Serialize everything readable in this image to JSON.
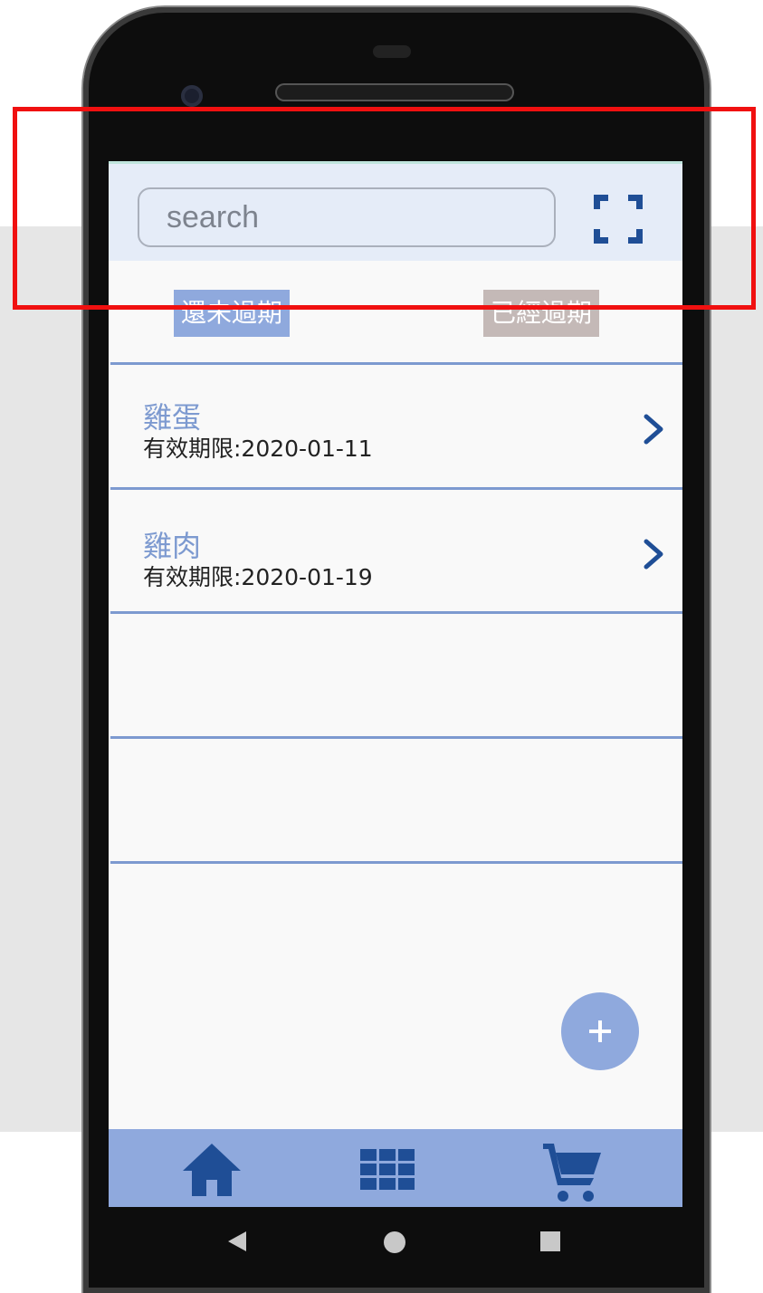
{
  "colors": {
    "accent": "#8fa9dd",
    "divider": "#7d9ad0",
    "title_text": "#7d9ad0",
    "expired_tab": "#c4b9b7",
    "header_bg": "#e5ecf8",
    "highlight": "#f01010"
  },
  "search": {
    "placeholder": "search",
    "scan_icon": "fullscreen-scan-icon"
  },
  "tabs": [
    {
      "label": "還未過期",
      "state": "active"
    },
    {
      "label": "已經過期",
      "state": "inactive"
    }
  ],
  "items": [
    {
      "name": "雞蛋",
      "expiry": "有效期限:2020-01-11"
    },
    {
      "name": "雞肉",
      "expiry": "有效期限:2020-01-19"
    }
  ],
  "fab": {
    "icon": "plus-icon",
    "label": "+"
  },
  "bottom_nav": [
    {
      "icon": "home-icon"
    },
    {
      "icon": "grid-icon"
    },
    {
      "icon": "cart-icon"
    }
  ],
  "system_nav": [
    {
      "icon": "back-icon"
    },
    {
      "icon": "home-circle-icon"
    },
    {
      "icon": "recents-icon"
    }
  ]
}
